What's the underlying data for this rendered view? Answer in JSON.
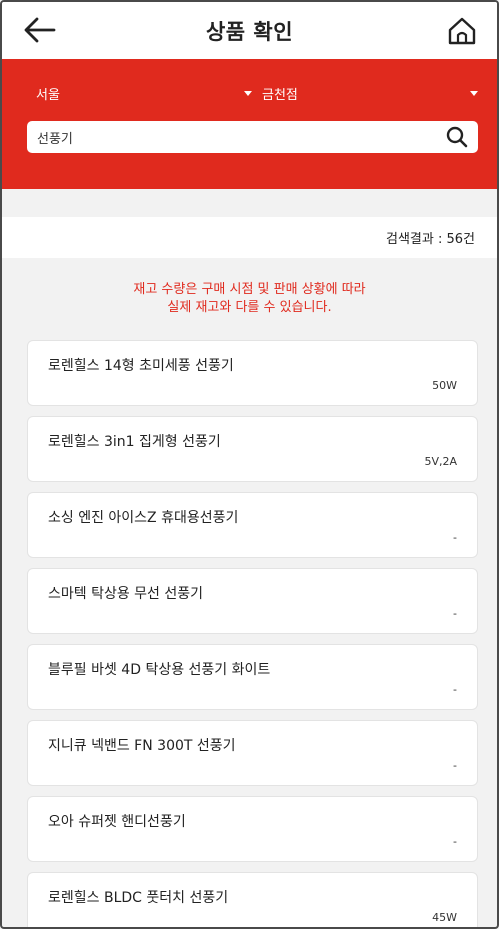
{
  "header": {
    "title": "상품 확인",
    "back_icon": "arrow-left-icon",
    "home_icon": "home-icon"
  },
  "filters": {
    "region": "서울",
    "store": "금천점"
  },
  "search": {
    "value": "선풍기",
    "icon": "search-icon"
  },
  "results": {
    "count_label": "검색결과 : 56건"
  },
  "notice": {
    "line1": "재고 수량은 구매 시점 및 판매 상황에 따라",
    "line2": "실제 재고와 다를 수 있습니다."
  },
  "products": [
    {
      "name": "로렌힐스 14형 초미세풍 선풍기",
      "spec": "50W"
    },
    {
      "name": "로렌힐스 3in1 집게형 선풍기",
      "spec": "5V,2A"
    },
    {
      "name": "소싱 엔진 아이스Z 휴대용선풍기",
      "spec": "-"
    },
    {
      "name": "스마텍 탁상용 무선 선풍기",
      "spec": "-"
    },
    {
      "name": "블루필 바셋 4D 탁상용 선풍기 화이트",
      "spec": "-"
    },
    {
      "name": "지니큐 넥밴드 FN 300T 선풍기",
      "spec": "-"
    },
    {
      "name": "오아 슈퍼젯 핸디선풍기",
      "spec": "-"
    },
    {
      "name": "로렌힐스 BLDC 풋터치 선풍기",
      "spec": "45W"
    }
  ],
  "colors": {
    "brand_red": "#e02a1e",
    "background": "#f2f2f2"
  }
}
